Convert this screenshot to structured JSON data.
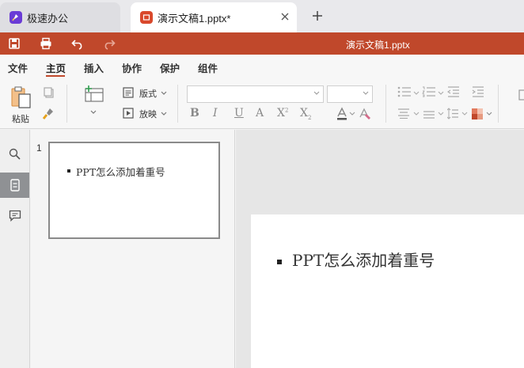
{
  "tabs": [
    {
      "title": "极速办公",
      "logo_color": "#6a3bd6"
    },
    {
      "title": "演示文稿1.pptx*",
      "logo_color": "#d9482b"
    }
  ],
  "titlebar": {
    "doc_title": "演示文稿1.pptx",
    "color": "#c0482b"
  },
  "menu": {
    "items": [
      "文件",
      "主页",
      "插入",
      "协作",
      "保护",
      "组件"
    ],
    "active": "主页"
  },
  "ribbon": {
    "paste_label": "粘贴",
    "layout_label": "版式",
    "play_label": "放映",
    "font_name_value": "",
    "font_size_value": ""
  },
  "slides_panel": {
    "slide_number": "1",
    "thumb_text": "PPT怎么添加着重号"
  },
  "editor": {
    "slide_text": "PPT怎么添加着重号"
  }
}
